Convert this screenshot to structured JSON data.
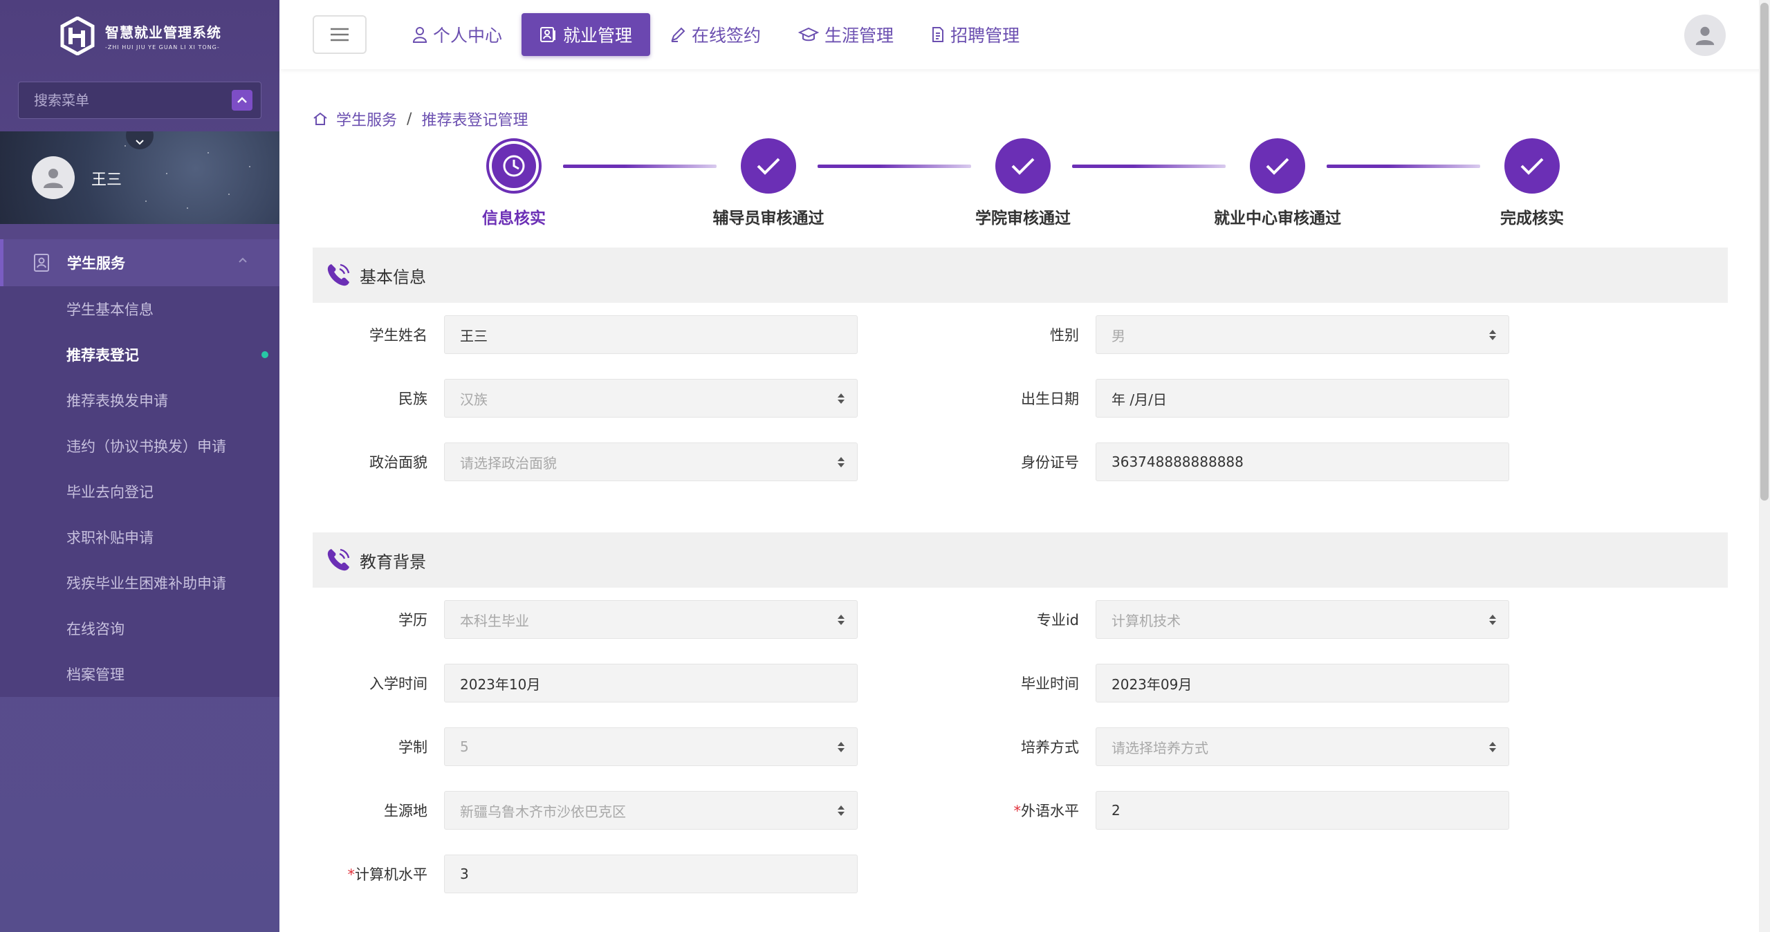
{
  "brand": {
    "title": "智慧就业管理系统",
    "subtitle": "-ZHI HUI JIU YE GUAN LI XI TONG-"
  },
  "menu_search": {
    "placeholder": "搜索菜单"
  },
  "user": {
    "name": "王三"
  },
  "sidebar": {
    "group": {
      "label": "学生服务",
      "icon": "student-id-icon"
    },
    "items": [
      {
        "label": "学生基本信息",
        "active": false
      },
      {
        "label": "推荐表登记",
        "active": true
      },
      {
        "label": "推荐表换发申请",
        "active": false
      },
      {
        "label": "违约（协议书换发）申请",
        "active": false
      },
      {
        "label": "毕业去向登记",
        "active": false
      },
      {
        "label": "求职补贴申请",
        "active": false
      },
      {
        "label": "残疾毕业生困难补助申请",
        "active": false
      },
      {
        "label": "在线咨询",
        "active": false
      },
      {
        "label": "档案管理",
        "active": false
      }
    ]
  },
  "topnav": {
    "tabs": [
      {
        "label": "个人中心",
        "icon": "user-icon",
        "active": false
      },
      {
        "label": "就业管理",
        "icon": "id-card-icon",
        "active": true
      },
      {
        "label": "在线签约",
        "icon": "pen-icon",
        "active": false
      },
      {
        "label": "生涯管理",
        "icon": "graduation-cap-icon",
        "active": false
      },
      {
        "label": "招聘管理",
        "icon": "document-icon",
        "active": false
      }
    ]
  },
  "breadcrumb": {
    "root": "学生服务",
    "sep": "/",
    "current": "推荐表登记管理"
  },
  "steps": [
    {
      "label": "信息核实",
      "state": "current"
    },
    {
      "label": "辅导员审核通过",
      "state": "done"
    },
    {
      "label": "学院审核通过",
      "state": "done"
    },
    {
      "label": "就业中心审核通过",
      "state": "done"
    },
    {
      "label": "完成核实",
      "state": "done"
    }
  ],
  "sections": {
    "basic": {
      "title": "基本信息",
      "fields": {
        "name": {
          "label": "学生姓名",
          "value": "王三"
        },
        "gender": {
          "label": "性别",
          "value": "男"
        },
        "ethnicity": {
          "label": "民族",
          "value": "汉族"
        },
        "birth": {
          "label": "出生日期",
          "value": "年 /月/日"
        },
        "political": {
          "label": "政治面貌",
          "value": "请选择政治面貌"
        },
        "idcard": {
          "label": "身份证号",
          "value": "363748888888888"
        }
      }
    },
    "education": {
      "title": "教育背景",
      "fields": {
        "degree": {
          "label": "学历",
          "value": "本科生毕业"
        },
        "major": {
          "label": "专业id",
          "value": "计算机技术"
        },
        "enroll": {
          "label": "入学时间",
          "value": "2023年10月"
        },
        "graduate": {
          "label": "毕业时间",
          "value": "2023年09月"
        },
        "years": {
          "label": "学制",
          "value": "5"
        },
        "training": {
          "label": "培养方式",
          "value": "请选择培养方式"
        },
        "origin": {
          "label": "生源地",
          "value": "新疆乌鲁木齐市沙依巴克区"
        },
        "foreign": {
          "label": "外语水平",
          "required": "*",
          "value": "2"
        },
        "computer": {
          "label": "计算机水平",
          "required": "*",
          "value": "3"
        }
      }
    }
  },
  "colors": {
    "primary": "#6b2fb5",
    "sidebar": "#564d8c",
    "active_dot": "#27c8a5",
    "required": "#e0323c"
  }
}
